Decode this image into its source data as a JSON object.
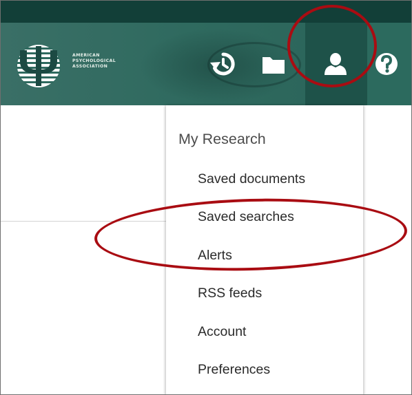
{
  "header": {
    "logo": {
      "name": "apa-logo",
      "text_lines": [
        "AMERICAN",
        "PSYCHOLOGICAL",
        "ASSOCIATION"
      ]
    },
    "icons": {
      "history": "history-icon",
      "folder": "folder-icon",
      "user": "user-icon",
      "help": "help-icon"
    }
  },
  "menu": {
    "title": "My Research",
    "items": [
      {
        "label": "Saved documents"
      },
      {
        "label": "Saved searches"
      },
      {
        "label": "Alerts"
      },
      {
        "label": "RSS feeds"
      },
      {
        "label": "Account"
      },
      {
        "label": "Preferences"
      }
    ]
  },
  "colors": {
    "header_bg": "#2f6a5f",
    "header_strip": "#123f38",
    "active_tab": "#1e5249",
    "annotation_red": "#a90c12",
    "menu_text": "#2a2a2a"
  }
}
